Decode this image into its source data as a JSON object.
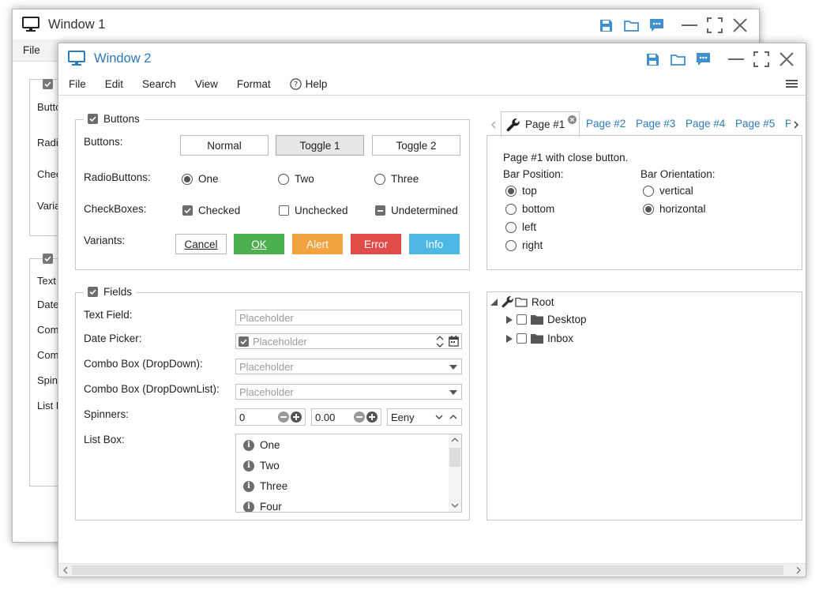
{
  "colors": {
    "accent": "#2b7bb9",
    "ok": "#4caf50",
    "alert": "#f0a33e",
    "error": "#e04a47",
    "info": "#4db8e3",
    "icon_blue": "#3f8fd2"
  },
  "window1": {
    "title": "Window 1",
    "menu": {
      "file": "File"
    },
    "panel1_labels": [
      "Butto",
      "Radio",
      "Chec",
      "Varia"
    ],
    "panel2_labels": [
      "Text",
      "Date",
      "Com",
      "Com",
      "Spin",
      "List B"
    ]
  },
  "window2": {
    "title": "Window 2",
    "menu": {
      "file": "File",
      "edit": "Edit",
      "search": "Search",
      "view": "View",
      "format": "Format",
      "help": "Help"
    },
    "buttons_panel": {
      "legend": "Buttons",
      "rows": {
        "buttons": "Buttons:",
        "radios": "RadioButtons:",
        "checkboxes": "CheckBoxes:",
        "variants": "Variants:"
      },
      "buttons": {
        "normal": "Normal",
        "toggle1": "Toggle 1",
        "toggle2": "Toggle 2"
      },
      "radios": {
        "one": "One",
        "two": "Two",
        "three": "Three"
      },
      "checkboxes": {
        "checked": "Checked",
        "unchecked": "Unchecked",
        "undetermined": "Undetermined"
      },
      "variants": {
        "cancel": "Cancel",
        "ok": "OK",
        "alert": "Alert",
        "error": "Error",
        "info": "Info"
      }
    },
    "fields_panel": {
      "legend": "Fields",
      "labels": {
        "text": "Text Field:",
        "date": "Date Picker:",
        "combo1": "Combo Box (DropDown):",
        "combo2": "Combo Box (DropDownList):",
        "spinners": "Spinners:",
        "listbox": "List Box:"
      },
      "placeholder": "Placeholder",
      "spinner1": "0",
      "spinner2": "0.00",
      "spinner3": "Eeny",
      "list_items": [
        "One",
        "Two",
        "Three",
        "Four"
      ]
    },
    "tabs": {
      "items": [
        "Page #1",
        "Page #2",
        "Page #3",
        "Page #4",
        "Page #5",
        "P"
      ],
      "content": {
        "heading": "Page #1 with close button.",
        "bar_position_label": "Bar Position:",
        "bar_orientation_label": "Bar Orientation:",
        "positions": [
          "top",
          "bottom",
          "left",
          "right"
        ],
        "orientations": [
          "vertical",
          "horizontal"
        ]
      }
    },
    "tree": {
      "root": "Root",
      "children": [
        "Desktop",
        "Inbox"
      ]
    }
  }
}
